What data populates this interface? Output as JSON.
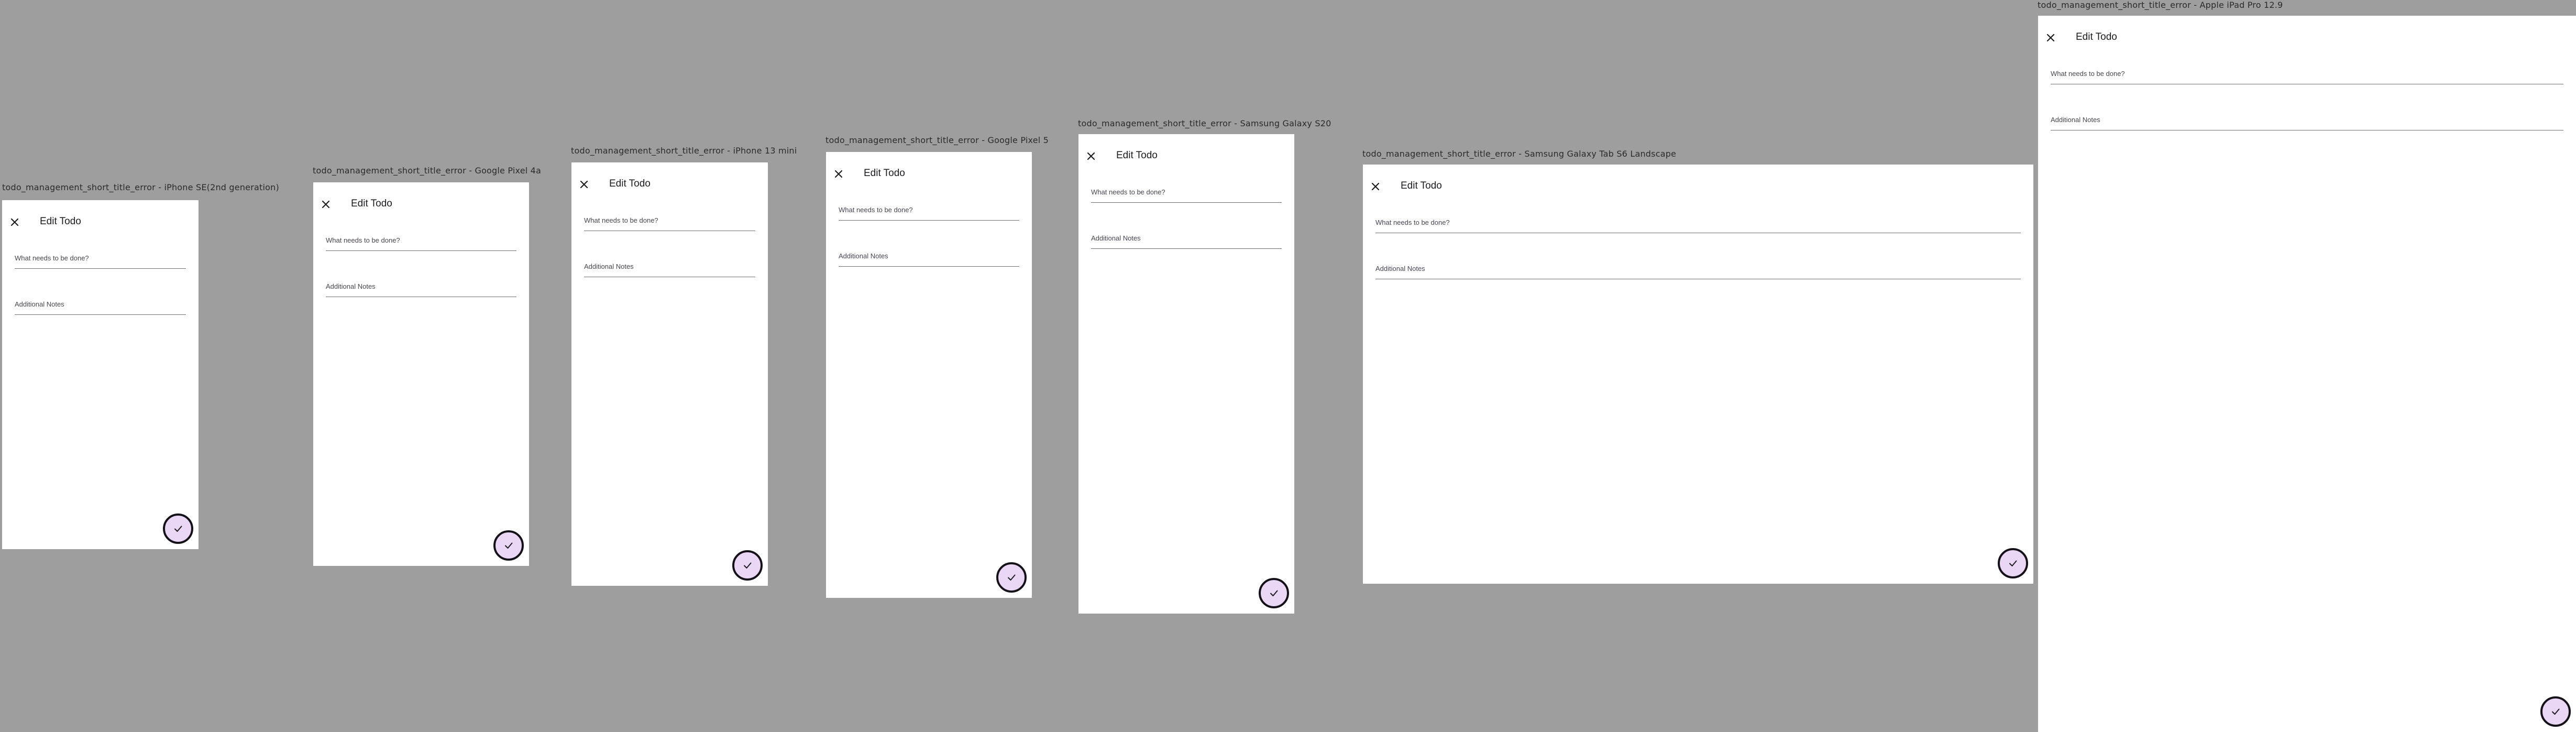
{
  "screen": {
    "title": "Edit Todo",
    "title_placeholder": "What needs to be done?",
    "notes_placeholder": "Additional Notes",
    "icons": {
      "close": "close-icon",
      "save": "check-icon"
    }
  },
  "devices": [
    {
      "label": "todo_management_short_title_error - iPhone SE(2nd generation)"
    },
    {
      "label": "todo_management_short_title_error - Google Pixel 4a"
    },
    {
      "label": "todo_management_short_title_error - iPhone 13 mini"
    },
    {
      "label": "todo_management_short_title_error - Google Pixel 5"
    },
    {
      "label": "todo_management_short_title_error - Samsung Galaxy S20"
    },
    {
      "label": "todo_management_short_title_error - Samsung Galaxy Tab S6 Landscape"
    },
    {
      "label": "todo_management_short_title_error - Apple iPad Pro 12.9"
    }
  ],
  "colors": {
    "canvas": "#9e9e9e",
    "screen": "#ffffff",
    "fab_fill": "#ead6f5",
    "fab_border": "#141218",
    "text": "#1c1b1f",
    "hint": "#49454f"
  }
}
